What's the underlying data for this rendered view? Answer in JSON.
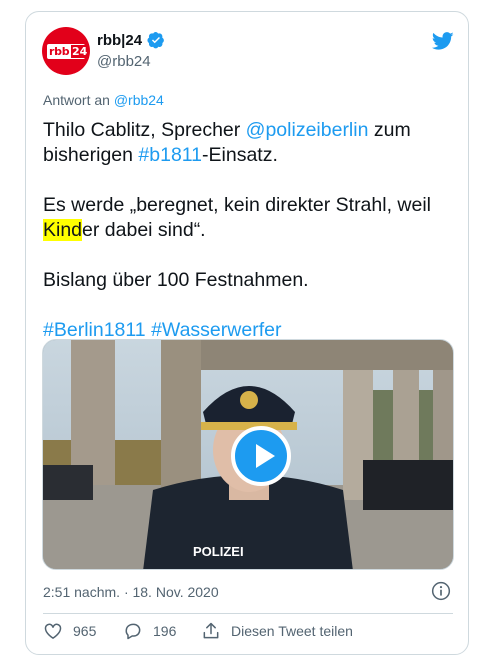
{
  "account": {
    "display_name": "rbb|24",
    "handle": "@rbb24",
    "avatar_logo": "rbb|24"
  },
  "reply_to": {
    "prefix": "Antwort an ",
    "handle": "@rbb24"
  },
  "tweet": {
    "line1_a": "Thilo Cablitz, Sprecher ",
    "mention": "@polizeiberlin",
    "line1_b": " zum bisherigen ",
    "hashtag1": "#b1811",
    "line1_c": "-Einsatz.",
    "line2_a": "Es werde „beregnet, kein direkter Strahl, weil ",
    "line2_highlight": "Kind",
    "line2_b": "er dabei sind“.",
    "line3": "Bislang über 100 Festnahmen.",
    "hashtag2": "#Berlin1811",
    "hashtag3": "#Wasserwerfer"
  },
  "media": {
    "type": "video",
    "uniform_label": "POLIZEI"
  },
  "timestamp": "2:51 nachm. · 18. Nov. 2020",
  "actions": {
    "likes": "965",
    "replies": "196",
    "share_label": "Diesen Tweet teilen"
  },
  "colors": {
    "link": "#1d9bf0",
    "highlight": "#ffff00",
    "brand_red": "#e2001a"
  },
  "icons": [
    "verified-badge-icon",
    "twitter-bird-icon",
    "play-icon",
    "info-icon",
    "heart-icon",
    "reply-icon",
    "share-icon"
  ]
}
